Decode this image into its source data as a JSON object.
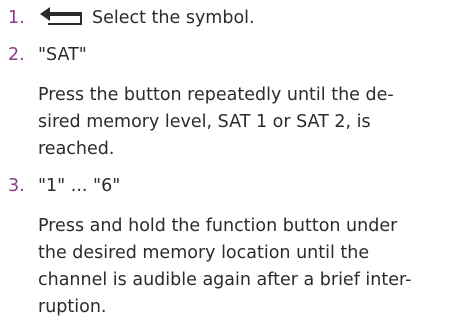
{
  "steps": [
    {
      "number": "1.",
      "icon": "back-arrow-icon",
      "text": "Select the symbol."
    },
    {
      "number": "2.",
      "text": "\"SAT\"",
      "description_lines": [
        "Press the button repeatedly until the de-",
        "sired memory level, SAT 1 or SAT 2, is",
        "reached."
      ]
    },
    {
      "number": "3.",
      "text": "\"1\" ... \"6\"",
      "description_lines": [
        "Press and hold the function button under",
        "the desired memory location until the",
        "channel is audible again after a brief inter-",
        "ruption."
      ]
    }
  ],
  "colors": {
    "step_number": "#8a3b8f",
    "text": "#2b2b2b"
  }
}
